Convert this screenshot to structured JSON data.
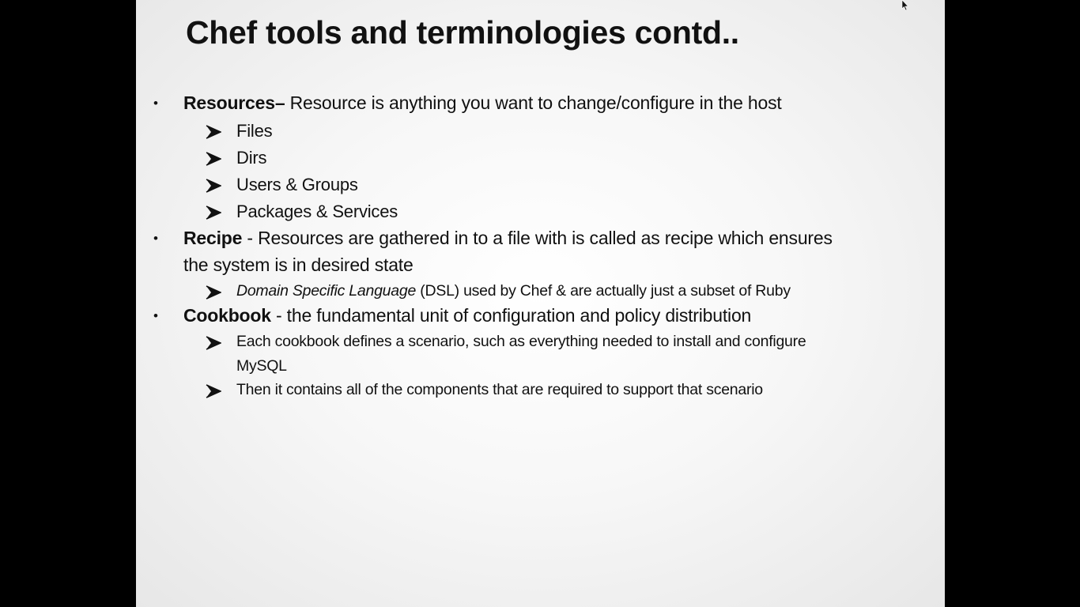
{
  "slide": {
    "title": "Chef tools and terminologies contd..",
    "bullet_char": "•",
    "resources": {
      "term": "Resources–",
      "text": " Resource is anything you want to change/configure in the host",
      "items": [
        "Files",
        "Dirs",
        "Users & Groups",
        "Packages & Services"
      ]
    },
    "recipe": {
      "term": "Recipe",
      "text_line1": " - Resources are gathered in to a file with is called as recipe which ensures",
      "text_line2": "the system is in desired state",
      "sub_italic": "Domain Specific Language",
      "sub_rest": " (DSL) used by Chef & are actually just a subset of Ruby"
    },
    "cookbook": {
      "term": "Cookbook",
      "text": " - the fundamental unit of configuration and policy distribution",
      "sub1_line1": "Each cookbook defines a scenario, such as everything needed to install and configure",
      "sub1_line2": "MySQL",
      "sub2": "Then it contains all of the components that are required to support that scenario"
    }
  },
  "colors": {
    "background": "#000000",
    "slide_center": "#ffffff",
    "slide_edge": "#e7e7e7",
    "text": "#111111"
  },
  "icons": {
    "sub_bullet": "arrow-bullet-icon",
    "cursor": "mouse-pointer-icon"
  }
}
